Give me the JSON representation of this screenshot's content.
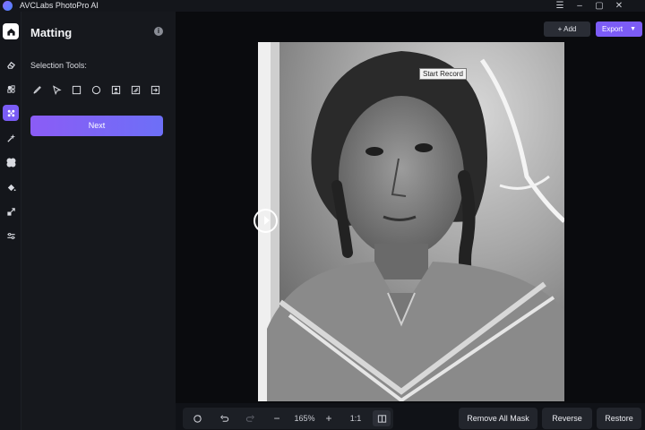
{
  "app": {
    "title": "AVCLabs PhotoPro AI"
  },
  "window": {
    "menu_icon": "menu-icon",
    "min_icon": "minimize-icon",
    "max_icon": "maximize-icon",
    "close_icon": "close-icon"
  },
  "rail": {
    "items": [
      {
        "icon": "home-icon",
        "state": "selected"
      },
      {
        "icon": "eraser-icon"
      },
      {
        "icon": "shapes-icon"
      },
      {
        "icon": "matting-icon",
        "state": "active"
      },
      {
        "icon": "sparkle-wand-icon"
      },
      {
        "icon": "pinwheel-icon"
      },
      {
        "icon": "paint-bucket-icon"
      },
      {
        "icon": "upscale-icon"
      },
      {
        "icon": "adjust-sliders-icon"
      }
    ]
  },
  "panel": {
    "title": "Matting",
    "info_icon": "info-icon",
    "section_label": "Selection Tools:",
    "tools": [
      "brush-icon",
      "pointer-icon",
      "rectangle-icon",
      "ellipse-icon",
      "portrait-select-icon",
      "pattern-select-icon",
      "import-icon"
    ],
    "next_label": "Next"
  },
  "header": {
    "add_label": "+ Add",
    "export_label": "Export"
  },
  "canvas": {
    "tooltip": "Start Record",
    "photo_subject": "vintage black-and-white portrait of a girl with braids"
  },
  "bottom": {
    "zoom_level": "165%",
    "ratio_label": "1:1",
    "remove_all_mask_label": "Remove All Mask",
    "reverse_label": "Reverse",
    "restore_label": "Restore"
  },
  "colors": {
    "accent": "#7c5cf6",
    "panel_bg": "#16181d",
    "canvas_bg": "#0a0b0e"
  }
}
